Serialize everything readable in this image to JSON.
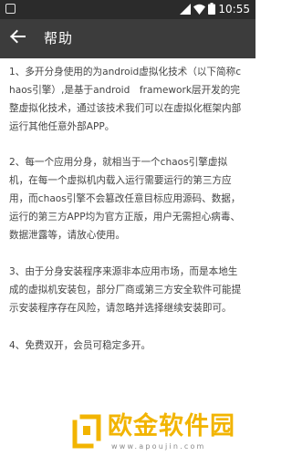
{
  "status_bar": {
    "time": "10:55",
    "icons": [
      "signal-icon",
      "wifi-icon",
      "battery-icon"
    ]
  },
  "app_bar": {
    "title": "帮助",
    "back_icon": "arrow-left-icon"
  },
  "content": {
    "paragraphs": [
      "1、多开分身使用的为android虚拟化技术（以下简称chaos引擎）,是基于android　framework层开发的完整虚拟化技术，通过该技术我们可以在虚拟化框架内部运行其他任意外部APP。",
      "2、每一个应用分身，就相当于一个chaos引擎虚拟机，在每一个虚拟机内载入运行需要运行的第三方应用，而chaos引擎不会篡改任意目标应用源码、数据，运行的第三方APP均为官方正版，用户无需担心病毒、数据泄露等，请放心使用。",
      "3、由于分身安装程序来源非本应用市场，而是本地生成的虚拟机安装包，部分厂商或第三方安全软件可能提示安装程序存在风险，请忽略并选择继续安装即可。",
      "4、免费双开，会员可稳定多开。"
    ]
  },
  "watermark": {
    "brand": "欧金软件园",
    "url": "www.apoujin.com",
    "color": "#f2b400"
  }
}
